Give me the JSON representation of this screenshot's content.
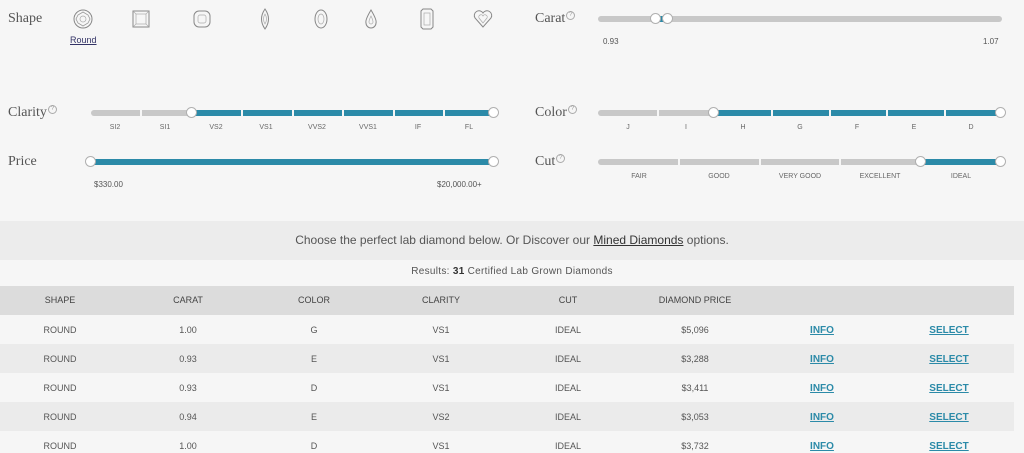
{
  "filters": {
    "shape": {
      "label": "Shape",
      "selected": "Round",
      "shapes": [
        "round-icon",
        "princess-icon",
        "cushion-icon",
        "marquise-icon",
        "oval-icon",
        "pear-icon",
        "emerald-icon",
        "heart-icon"
      ]
    },
    "carat": {
      "label": "Carat",
      "help": "?",
      "min": "0.93",
      "max": "1.07",
      "range": [
        0.93,
        1.07
      ]
    },
    "clarity": {
      "label": "Clarity",
      "help": "?",
      "ticks": [
        "SI2",
        "SI1",
        "VS2",
        "VS1",
        "VVS2",
        "VVS1",
        "IF",
        "FL"
      ],
      "selected_from": "VS2",
      "selected_to": "FL"
    },
    "color": {
      "label": "Color",
      "help": "?",
      "ticks": [
        "J",
        "I",
        "H",
        "G",
        "F",
        "E",
        "D"
      ],
      "selected_from": "H",
      "selected_to": "D"
    },
    "price": {
      "label": "Price",
      "min": "$330.00",
      "max": "$20,000.00+"
    },
    "cut": {
      "label": "Cut",
      "help": "?",
      "ticks": [
        "FAIR",
        "GOOD",
        "VERY GOOD",
        "EXCELLENT",
        "IDEAL"
      ],
      "selected": "IDEAL"
    }
  },
  "banner": {
    "prefix": "Choose the perfect lab diamond below. Or Discover our",
    "link": "Mined Diamonds",
    "suffix": "options."
  },
  "results": {
    "prefix": "Results:",
    "count": "31",
    "suffix": "Certified Lab Grown Diamonds"
  },
  "table": {
    "headers": [
      "SHAPE",
      "CARAT",
      "COLOR",
      "CLARITY",
      "CUT",
      "DIAMOND PRICE"
    ],
    "info_label": "INFO",
    "select_label": "SELECT",
    "rows": [
      {
        "shape": "ROUND",
        "carat": "1.00",
        "color": "G",
        "clarity": "VS1",
        "cut": "IDEAL",
        "price": "$5,096"
      },
      {
        "shape": "ROUND",
        "carat": "0.93",
        "color": "E",
        "clarity": "VS1",
        "cut": "IDEAL",
        "price": "$3,288"
      },
      {
        "shape": "ROUND",
        "carat": "0.93",
        "color": "D",
        "clarity": "VS1",
        "cut": "IDEAL",
        "price": "$3,411"
      },
      {
        "shape": "ROUND",
        "carat": "0.94",
        "color": "E",
        "clarity": "VS2",
        "cut": "IDEAL",
        "price": "$3,053"
      },
      {
        "shape": "ROUND",
        "carat": "1.00",
        "color": "D",
        "clarity": "VS1",
        "cut": "IDEAL",
        "price": "$3,732"
      }
    ]
  },
  "colors": {
    "accent": "#2b8aa8",
    "track": "#c8c8c8"
  }
}
